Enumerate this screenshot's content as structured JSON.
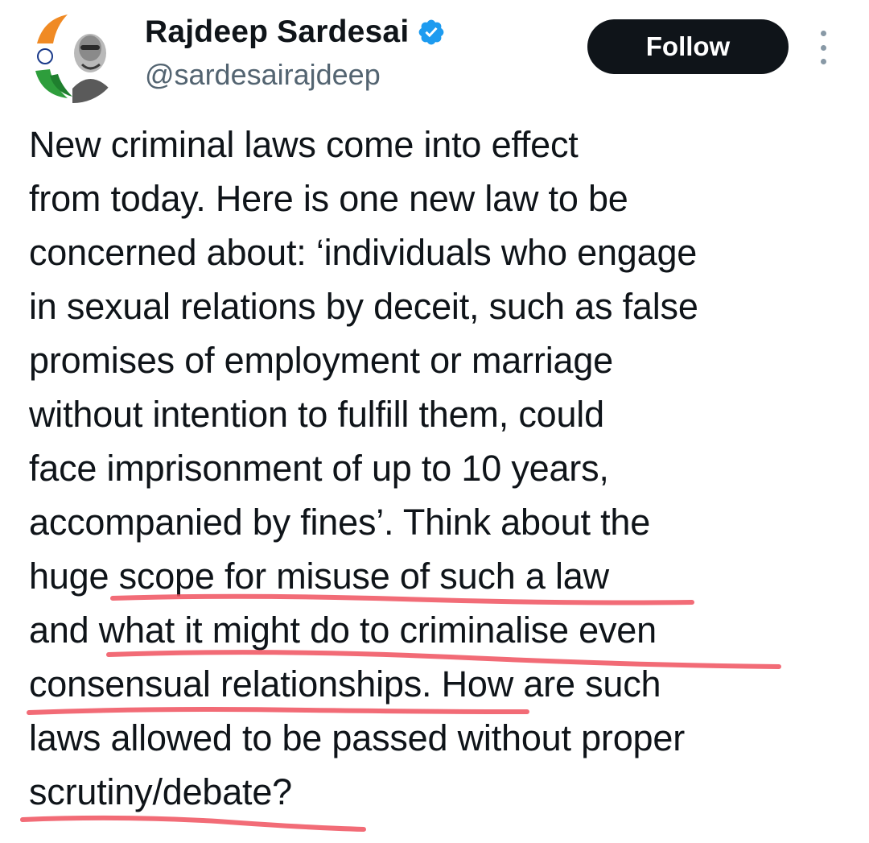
{
  "tweet": {
    "author": {
      "display_name": "Rajdeep Sardesai",
      "handle": "@sardesairajdeep",
      "verified": true,
      "verified_color": "#1d9bf0",
      "avatar_icon": "profile-avatar"
    },
    "follow_label": "Follow",
    "more_icon": "more-options-icon",
    "text_lines": [
      "New criminal laws come into effect",
      "from today. Here is one new law to be",
      "concerned about: ‘individuals who engage",
      "in sexual relations by deceit, such as false",
      "promises of employment or marriage",
      "without intention to fulfill them, could",
      "face imprisonment of up to 10 years,",
      "accompanied by fines’. Think about the",
      "huge scope for misuse of such a law",
      "and what it might do to criminalise even",
      "consensual relationships. How are such",
      "laws allowed to be passed without proper",
      "scrutiny/debate?"
    ]
  },
  "annotation": {
    "underline_color": "#f0525f"
  }
}
